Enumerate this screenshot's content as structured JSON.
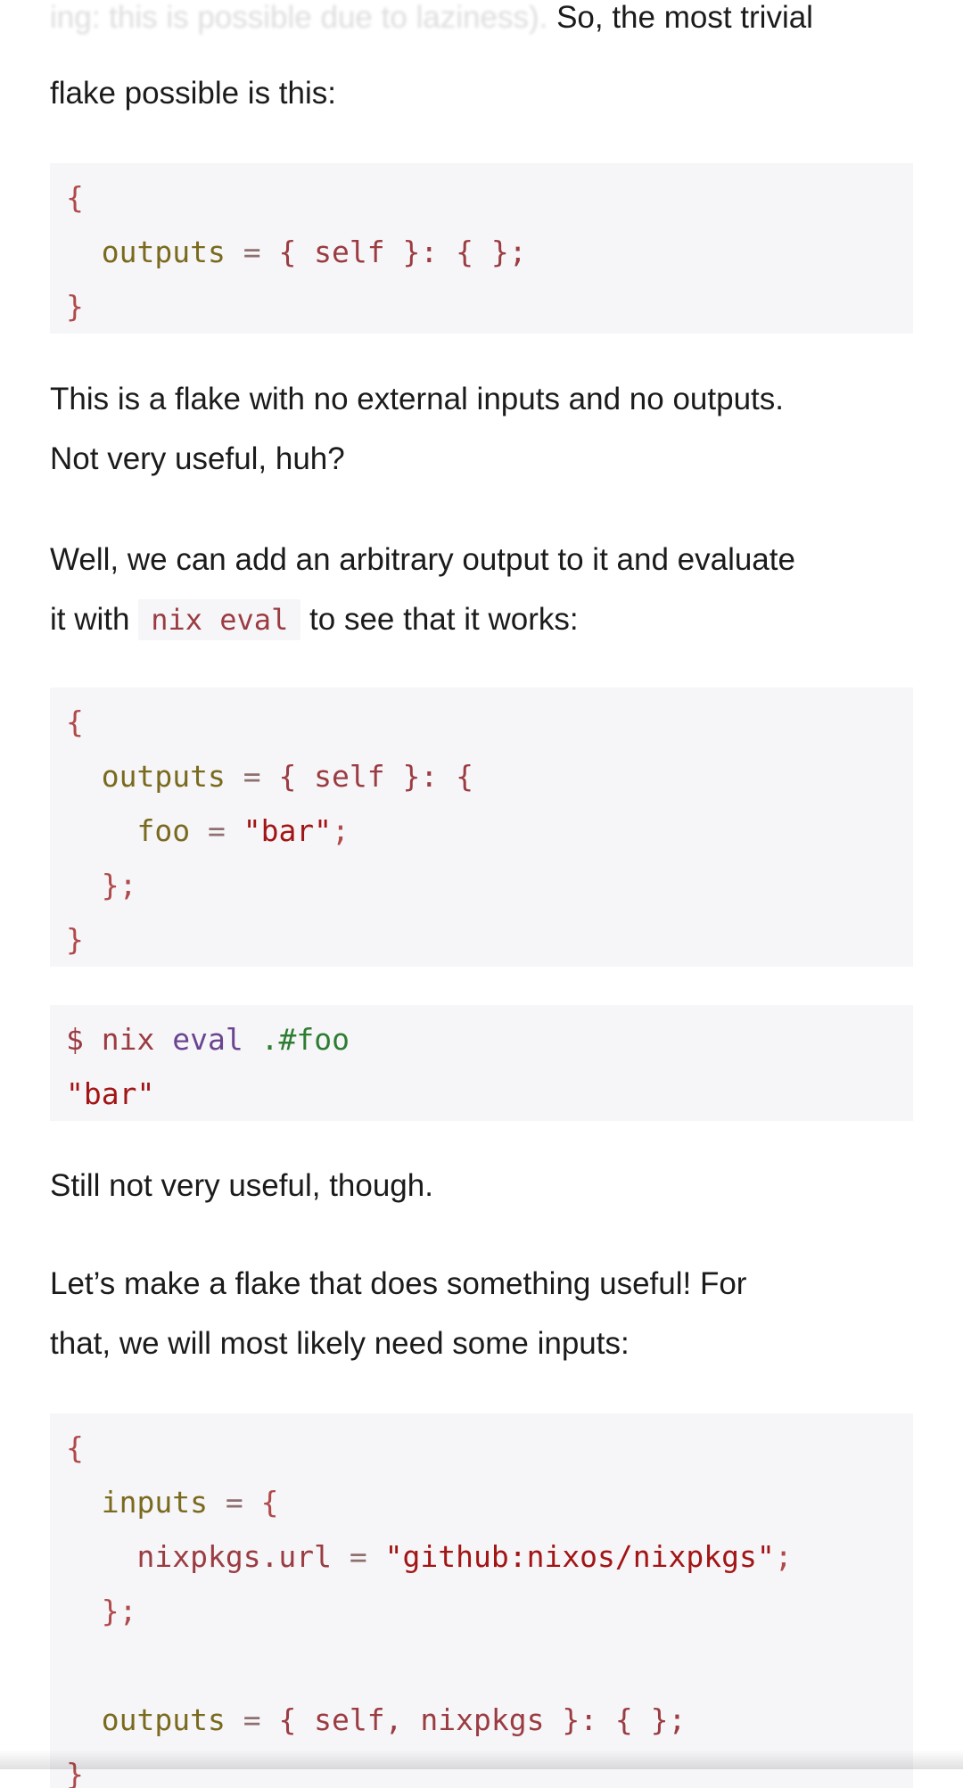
{
  "intro": {
    "faded_text": "ing: this is possible due to laziness).",
    "visible_text": "So, the most trivial",
    "line2": "flake possible is this:"
  },
  "code1": {
    "l1": "{",
    "l2_attr": "outputs",
    "l2_eq": " = ",
    "l2_rest": "{ self }: { };",
    "l3": "}"
  },
  "para1": {
    "l1": "This is a flake with no external inputs and no outputs.",
    "l2": "Not very useful, huh?"
  },
  "para2": {
    "l1": "Well, we can add an arbitrary output to it and evaluate",
    "l2_pre": "it with ",
    "l2_code": "nix eval",
    "l2_post": " to see that it works:"
  },
  "code2": {
    "l1": "{",
    "l2_attr": "outputs",
    "l2_eq": " = ",
    "l2_rest": "{ self }: {",
    "l3_attr": "foo",
    "l3_eq": " = ",
    "l3_str": "\"bar\"",
    "l3_semi": ";",
    "l4": "};",
    "l5": "}"
  },
  "terminal": {
    "prompt": "$ ",
    "cmd1": "nix",
    "cmd2": "eval",
    "arg": ".#foo",
    "output": "\"bar\""
  },
  "para3": "Still not very useful, though.",
  "para4": {
    "l1": "Let’s make a flake that does something useful! For",
    "l2": "that, we will most likely need some inputs:"
  },
  "code3": {
    "l1": "{",
    "l2_attr": "inputs",
    "l2_eq": " = ",
    "l2_rest": "{",
    "l3_attr": "nixpkgs.url",
    "l3_eq": " = ",
    "l3_str": "\"github:nixos/nixpkgs\"",
    "l3_semi": ";",
    "l4": "};",
    "l6_attr": "outputs",
    "l6_eq": " = ",
    "l6_rest": "{ self, nixpkgs }: { };",
    "l7": "}"
  }
}
